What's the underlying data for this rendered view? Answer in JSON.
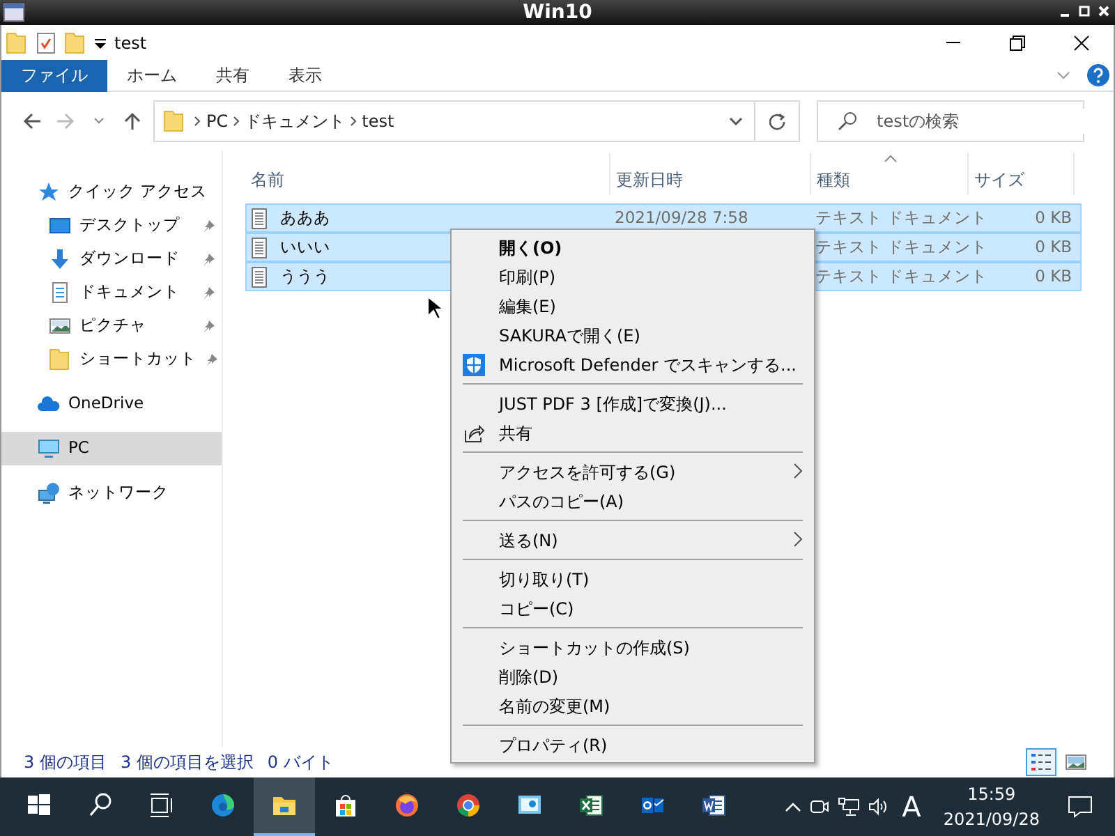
{
  "outer_window": {
    "title": "Win10"
  },
  "explorer": {
    "title": "test",
    "ribbon_tabs": [
      {
        "label": "ファイル",
        "selected": true
      },
      {
        "label": "ホーム",
        "selected": false
      },
      {
        "label": "共有",
        "selected": false
      },
      {
        "label": "表示",
        "selected": false
      }
    ],
    "address": {
      "crumbs": [
        "PC",
        "ドキュメント",
        "test"
      ]
    },
    "search": {
      "placeholder": "testの検索"
    },
    "sidebar": {
      "items": [
        {
          "label": "クイック アクセス",
          "pinned": false,
          "selected": false,
          "children": [
            {
              "label": "デスクトップ",
              "pinned": true,
              "selected": false
            },
            {
              "label": "ダウンロード",
              "pinned": true,
              "selected": false
            },
            {
              "label": "ドキュメント",
              "pinned": true,
              "selected": false
            },
            {
              "label": "ピクチャ",
              "pinned": true,
              "selected": false
            },
            {
              "label": "ショートカット",
              "pinned": true,
              "selected": false
            }
          ]
        },
        {
          "label": "OneDrive",
          "pinned": false,
          "selected": false
        },
        {
          "label": "PC",
          "pinned": false,
          "selected": true
        },
        {
          "label": "ネットワーク",
          "pinned": false,
          "selected": false
        }
      ]
    },
    "columns": [
      {
        "label": "名前",
        "sorted": false
      },
      {
        "label": "更新日時",
        "sorted": false
      },
      {
        "label": "種類",
        "sorted": true
      },
      {
        "label": "サイズ",
        "sorted": false
      }
    ],
    "files": [
      {
        "name": "あああ",
        "date": "2021/09/28 7:58",
        "type": "テキスト ドキュメント",
        "size": "0 KB",
        "selected": true
      },
      {
        "name": "いいい",
        "type": "テキスト ドキュメント",
        "size": "0 KB",
        "selected": true
      },
      {
        "name": "ううう",
        "type": "テキスト ドキュメント",
        "size": "0 KB",
        "selected": true
      }
    ],
    "status_bar": {
      "item_count": "3 個の項目",
      "selection": "3 個の項目を選択",
      "size": "0 バイト",
      "views": [
        {
          "kind": "details",
          "selected": true
        },
        {
          "kind": "thumbnails",
          "selected": false
        }
      ]
    }
  },
  "context_menu": {
    "items": [
      {
        "kind": "item",
        "label": "開く(O)",
        "default": true
      },
      {
        "kind": "item",
        "label": "印刷(P)"
      },
      {
        "kind": "item",
        "label": "編集(E)"
      },
      {
        "kind": "item",
        "label": "SAKURAで開く(E)"
      },
      {
        "kind": "item",
        "label": "Microsoft Defender でスキャンする..."
      },
      {
        "kind": "separator"
      },
      {
        "kind": "item",
        "label": "JUST PDF 3 [作成]で変換(J)..."
      },
      {
        "kind": "item",
        "label": "共有"
      },
      {
        "kind": "separator"
      },
      {
        "kind": "item",
        "label": "アクセスを許可する(G)",
        "submenu": true
      },
      {
        "kind": "item",
        "label": "パスのコピー(A)"
      },
      {
        "kind": "separator"
      },
      {
        "kind": "item",
        "label": "送る(N)",
        "submenu": true
      },
      {
        "kind": "separator"
      },
      {
        "kind": "item",
        "label": "切り取り(T)"
      },
      {
        "kind": "item",
        "label": "コピー(C)"
      },
      {
        "kind": "separator"
      },
      {
        "kind": "item",
        "label": "ショートカットの作成(S)"
      },
      {
        "kind": "item",
        "label": "削除(D)"
      },
      {
        "kind": "item",
        "label": "名前の変更(M)"
      },
      {
        "kind": "separator"
      },
      {
        "kind": "item",
        "label": "プロパティ(R)"
      }
    ]
  },
  "taskbar": {
    "apps": [
      {
        "kind": "start",
        "active": false
      },
      {
        "kind": "search",
        "active": false
      },
      {
        "kind": "taskview",
        "active": false
      },
      {
        "kind": "edge",
        "active": false
      },
      {
        "kind": "explorer",
        "active": true
      },
      {
        "kind": "store",
        "active": false
      },
      {
        "kind": "firefox",
        "active": false
      },
      {
        "kind": "chrome",
        "active": false
      },
      {
        "kind": "remote",
        "active": false
      },
      {
        "kind": "excel",
        "active": false
      },
      {
        "kind": "outlook",
        "active": false
      },
      {
        "kind": "word",
        "active": false
      }
    ],
    "tray": {
      "ime": "A",
      "time": "15:59",
      "date": "2021/09/28"
    }
  }
}
